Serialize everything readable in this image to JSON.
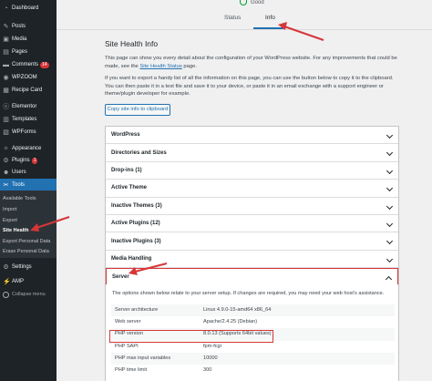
{
  "sidebar": {
    "items": [
      {
        "label": "Dashboard",
        "icon": "dashboard-icon",
        "glyph": "◔"
      },
      {
        "label": "Posts",
        "icon": "posts-icon",
        "glyph": "✎"
      },
      {
        "label": "Media",
        "icon": "media-icon",
        "glyph": "▣"
      },
      {
        "label": "Pages",
        "icon": "pages-icon",
        "glyph": "▤"
      },
      {
        "label": "Comments",
        "icon": "comments-icon",
        "glyph": "▬",
        "badge": "14"
      },
      {
        "label": "WPZOOM",
        "icon": "wpzoom-icon",
        "glyph": "◉"
      },
      {
        "label": "Recipe Card",
        "icon": "recipe-card-icon",
        "glyph": "▦"
      },
      {
        "label": "Elementor",
        "icon": "elementor-icon",
        "glyph": "ⓔ"
      },
      {
        "label": "Templates",
        "icon": "templates-icon",
        "glyph": "▥"
      },
      {
        "label": "WPForms",
        "icon": "wpforms-icon",
        "glyph": "▧"
      },
      {
        "label": "Appearance",
        "icon": "appearance-icon",
        "glyph": "✧"
      },
      {
        "label": "Plugins",
        "icon": "plugins-icon",
        "glyph": "⚙",
        "badge": "1"
      },
      {
        "label": "Users",
        "icon": "users-icon",
        "glyph": "☻"
      },
      {
        "label": "Tools",
        "icon": "tools-icon",
        "glyph": "✂"
      }
    ],
    "submenu": [
      "Available Tools",
      "Import",
      "Export",
      "Site Health",
      "Export Personal Data",
      "Erase Personal Data"
    ],
    "lower_items": [
      {
        "label": "Settings",
        "icon": "settings-icon",
        "glyph": "⚙"
      },
      {
        "label": "AMP",
        "icon": "amp-icon",
        "glyph": "⚡"
      }
    ],
    "collapse_label": "Collapse menu"
  },
  "header": {
    "site_title": "Good",
    "tabs": [
      "Status",
      "Info"
    ]
  },
  "main": {
    "title": "Site Health Info",
    "intro_text_1": "This page can show you every detail about the configuration of your WordPress website. For any improvements that could be made,",
    "intro_text_2": "see the",
    "intro_link": "Site Health Status",
    "intro_text_3": "page.",
    "instructions": "If you want to export a handy list of all the information on this page, you can use the button below to copy it to the clipboard. You can then paste it in a text file and save it to your device, or paste it in an email exchange with a support engineer or theme/plugin developer for example.",
    "copy_button": "Copy site info to clipboard",
    "sections": [
      "WordPress",
      "Directories and Sizes",
      "Drop-ins (1)",
      "Active Theme",
      "Inactive Themes (3)",
      "Active Plugins (12)",
      "Inactive Plugins (3)",
      "Media Handling",
      "Server"
    ],
    "server_description": "The options shown below relate to your server setup. If changes are required, you may need your web host's assistance.",
    "server_rows": [
      {
        "key": "Server architecture",
        "value": "Linux 4.9.0-15-amd64 x86_64"
      },
      {
        "key": "Web server",
        "value": "Apache/2.4.25 (Debian)"
      },
      {
        "key": "PHP version",
        "value": "8.0.13 (Supports 64bit values)"
      },
      {
        "key": "PHP SAPI",
        "value": "fpm-fcgi"
      },
      {
        "key": "PHP max input variables",
        "value": "10000"
      },
      {
        "key": "PHP time limit",
        "value": "300"
      }
    ]
  },
  "colors": {
    "sidebar_bg": "#1d2327",
    "active_blue": "#2271b1",
    "annotation_red": "#d63638"
  }
}
